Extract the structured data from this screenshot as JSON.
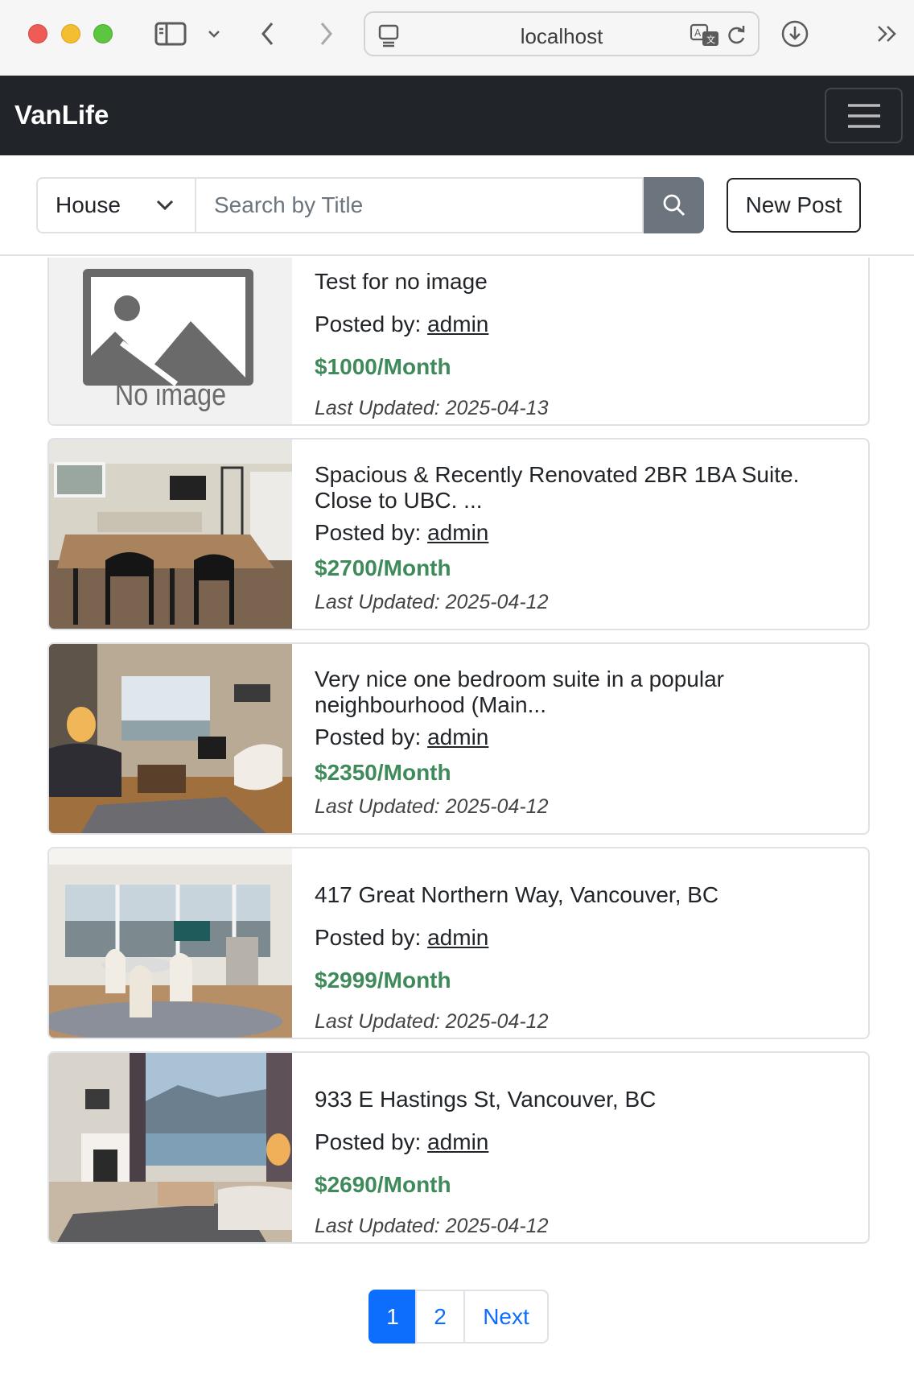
{
  "browser": {
    "url": "localhost"
  },
  "navbar": {
    "brand": "VanLife"
  },
  "search": {
    "category_selected": "House",
    "placeholder": "Search by Title",
    "new_post_label": "New Post"
  },
  "listings": [
    {
      "title": "Test for no image",
      "posted_by_label": "Posted by:",
      "author": "admin",
      "price": "$1000/Month",
      "updated": "Last Updated: 2025-04-13",
      "image": "No image"
    },
    {
      "title": "Spacious & Recently Renovated 2BR 1BA Suite. Close to UBC. ...",
      "posted_by_label": "Posted by:",
      "author": "admin",
      "price": "$2700/Month",
      "updated": "Last Updated: 2025-04-12"
    },
    {
      "title": "Very nice one bedroom suite in a popular neighbourhood (Main...",
      "posted_by_label": "Posted by:",
      "author": "admin",
      "price": "$2350/Month",
      "updated": "Last Updated: 2025-04-12"
    },
    {
      "title": "417 Great Northern Way, Vancouver, BC",
      "posted_by_label": "Posted by:",
      "author": "admin",
      "price": "$2999/Month",
      "updated": "Last Updated: 2025-04-12"
    },
    {
      "title": "933 E Hastings St, Vancouver, BC",
      "posted_by_label": "Posted by:",
      "author": "admin",
      "price": "$2690/Month",
      "updated": "Last Updated: 2025-04-12"
    }
  ],
  "pagination": {
    "page1": "1",
    "page2": "2",
    "next": "Next"
  },
  "colors": {
    "navbar_bg": "#212529",
    "price_green": "#3f8a5b",
    "primary_blue": "#0d6efd",
    "search_button": "#6c757d"
  }
}
